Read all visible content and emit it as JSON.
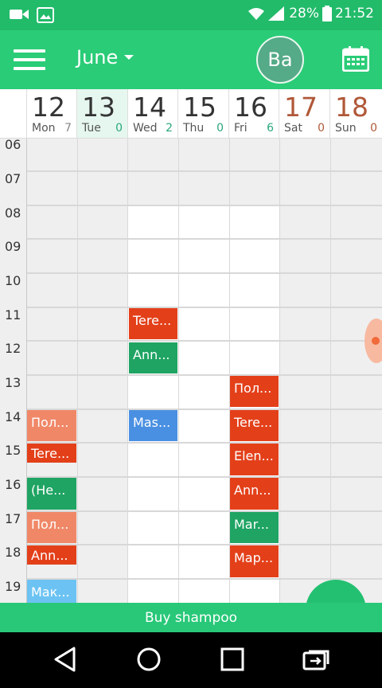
{
  "status_bar": {
    "battery": "28%",
    "time": "21:52",
    "icons": [
      "video-icon",
      "image-icon",
      "wifi-icon",
      "signal-icon",
      "battery-icon"
    ]
  },
  "toolbar": {
    "month": "June",
    "avatar_initials": "Ba",
    "menu_icon": "hamburger-icon",
    "calendar_icon": "calendar-icon"
  },
  "days": [
    {
      "num": "12",
      "name": "Mon",
      "count": "7"
    },
    {
      "num": "13",
      "name": "Tue",
      "count": "0"
    },
    {
      "num": "14",
      "name": "Wed",
      "count": "2"
    },
    {
      "num": "15",
      "name": "Thu",
      "count": "0"
    },
    {
      "num": "16",
      "name": "Fri",
      "count": "6"
    },
    {
      "num": "17",
      "name": "Sat",
      "count": "0"
    },
    {
      "num": "18",
      "name": "Sun",
      "count": "0"
    }
  ],
  "hours": [
    "06",
    "07",
    "08",
    "09",
    "10",
    "11",
    "12",
    "13",
    "14",
    "15",
    "16",
    "17",
    "18",
    "19"
  ],
  "events": [
    {
      "label": "Tere...",
      "color": "#e3401a"
    },
    {
      "label": "Ann...",
      "color": "#1fa463"
    },
    {
      "label": "Mas...",
      "color": "#4a90e2"
    },
    {
      "label": "Пол...",
      "color": "#e3401a"
    },
    {
      "label": "Tere...",
      "color": "#e3401a"
    },
    {
      "label": "Elen...",
      "color": "#e3401a"
    },
    {
      "label": "Ann...",
      "color": "#e3401a"
    },
    {
      "label": "Mar...",
      "color": "#1fa463"
    },
    {
      "label": "Мар...",
      "color": "#e3401a"
    },
    {
      "label": "Пол...",
      "color": "#f08868"
    },
    {
      "label": "Tere...",
      "color": "#e3401a"
    },
    {
      "label": "(He...",
      "color": "#1fa463"
    },
    {
      "label": "Пол...",
      "color": "#f08868"
    },
    {
      "label": "Ann...",
      "color": "#e3401a"
    },
    {
      "label": "Мак...",
      "color": "#6cc3f3"
    }
  ],
  "banner": {
    "text": "Buy shampoo"
  },
  "navbar": {
    "icons": [
      "back-icon",
      "home-icon",
      "recents-icon",
      "switch-icon"
    ]
  }
}
